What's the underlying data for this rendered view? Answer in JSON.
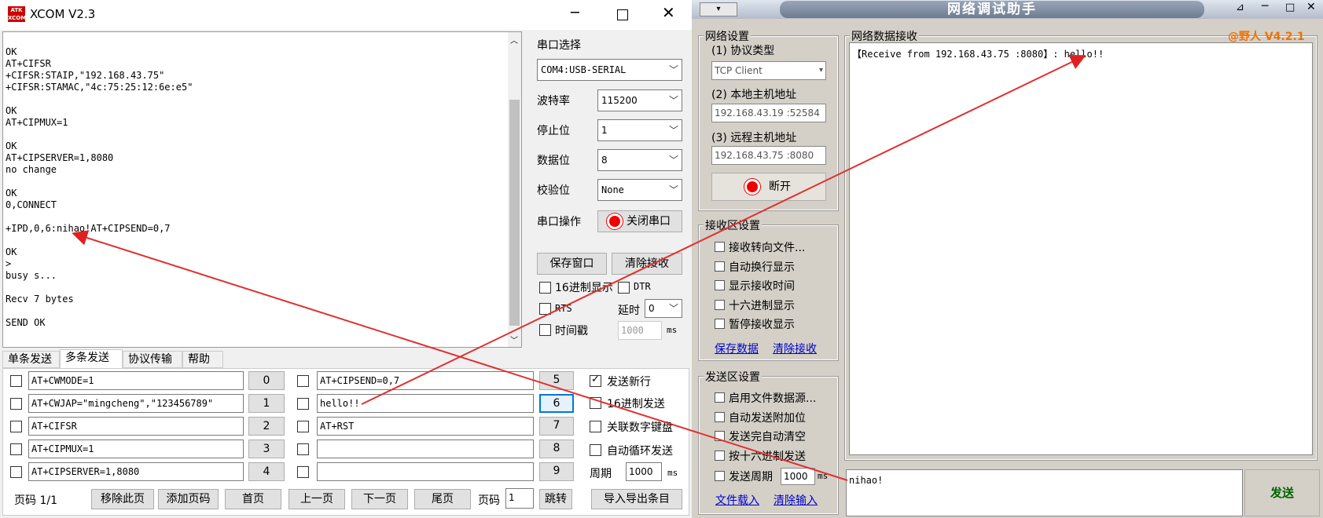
{
  "xcom": {
    "logo": "ATK XCOM",
    "title": "XCOM V2.3",
    "recv_lines": [
      "OK",
      "AT+CIFSR",
      "+CIFSR:STAIP,\"192.168.43.75\"",
      "+CIFSR:STAMAC,\"4c:75:25:12:6e:e5\"",
      "",
      "OK",
      "AT+CIPMUX=1",
      "",
      "OK",
      "AT+CIPSERVER=1,8080",
      "no change",
      "",
      "OK",
      "0,CONNECT",
      "",
      "+IPD,0,6:nihao!AT+CIPSEND=0,7",
      "",
      "OK",
      ">",
      "busy s...",
      "",
      "Recv 7 bytes",
      "",
      "SEND OK"
    ],
    "port_label": "串口选择",
    "port_value": "COM4:USB-SERIAL",
    "baud_label": "波特率",
    "baud_value": "115200",
    "stop_label": "停止位",
    "stop_value": "1",
    "data_label": "数据位",
    "data_value": "8",
    "parity_label": "校验位",
    "parity_value": "None",
    "op_label": "串口操作",
    "close_port": "关闭串口",
    "save_window": "保存窗口",
    "clear_recv": "清除接收",
    "hex_display": "16进制显示",
    "dtr": "DTR",
    "rts": "RTS",
    "delay_label": "延时",
    "delay_value": "0",
    "timestamp": "时间戳",
    "timestamp_value": "1000",
    "ms": "ms",
    "tabs": [
      "单条发送",
      "多条发送",
      "协议传输",
      "帮助"
    ],
    "cmds_left": [
      {
        "text": "AT+CWMODE=1",
        "num": "0"
      },
      {
        "text": "AT+CWJAP=\"mingcheng\",\"123456789\"",
        "num": "1"
      },
      {
        "text": "AT+CIFSR",
        "num": "2"
      },
      {
        "text": "AT+CIPMUX=1",
        "num": "3"
      },
      {
        "text": "AT+CIPSERVER=1,8080",
        "num": "4"
      }
    ],
    "cmds_right": [
      {
        "text": "AT+CIPSEND=0,7",
        "num": "5"
      },
      {
        "text": "hello!!",
        "num": "6"
      },
      {
        "text": "AT+RST",
        "num": "7"
      },
      {
        "text": "",
        "num": "8"
      },
      {
        "text": "",
        "num": "9"
      }
    ],
    "send_newline": "发送新行",
    "hex_send": "16进制发送",
    "link_keypad": "关联数字键盘",
    "auto_loop": "自动循环发送",
    "period_label": "周期",
    "period_value": "1000",
    "page_label": "页码 1/1",
    "remove_page": "移除此页",
    "add_page": "添加页码",
    "first_page": "首页",
    "prev_page": "上一页",
    "next_page": "下一页",
    "last_page": "尾页",
    "page_code": "页码",
    "page_code_value": "1",
    "jump": "跳转",
    "import_export": "导入导出条目"
  },
  "net": {
    "title": "网络调试助手",
    "version": "@野人 V4.2.1",
    "settings_group": "网络设置",
    "protocol_label": "(1) 协议类型",
    "protocol_value": "TCP Client",
    "local_label": "(2) 本地主机地址",
    "local_value": "192.168.43.19 :52584",
    "remote_label": "(3) 远程主机地址",
    "remote_value": "192.168.43.75 :8080",
    "disconnect": "断开",
    "recv_group": "接收区设置",
    "recv_opts": [
      "接收转向文件...",
      "自动换行显示",
      "显示接收时间",
      "十六进制显示",
      "暂停接收显示"
    ],
    "save_data": "保存数据",
    "clear_recv": "清除接收",
    "send_group": "发送区设置",
    "send_opts": [
      "启用文件数据源...",
      "自动发送附加位",
      "发送完自动清空",
      "按十六进制发送"
    ],
    "send_period": "发送周期",
    "send_period_value": "1000",
    "ms": "ms",
    "load_file": "文件载入",
    "clear_input": "清除输入",
    "data_recv_group": "网络数据接收",
    "recv_text": "【Receive from 192.168.43.75 :8080】: hello!!",
    "send_text": "nihao!",
    "send_button": "发送"
  }
}
